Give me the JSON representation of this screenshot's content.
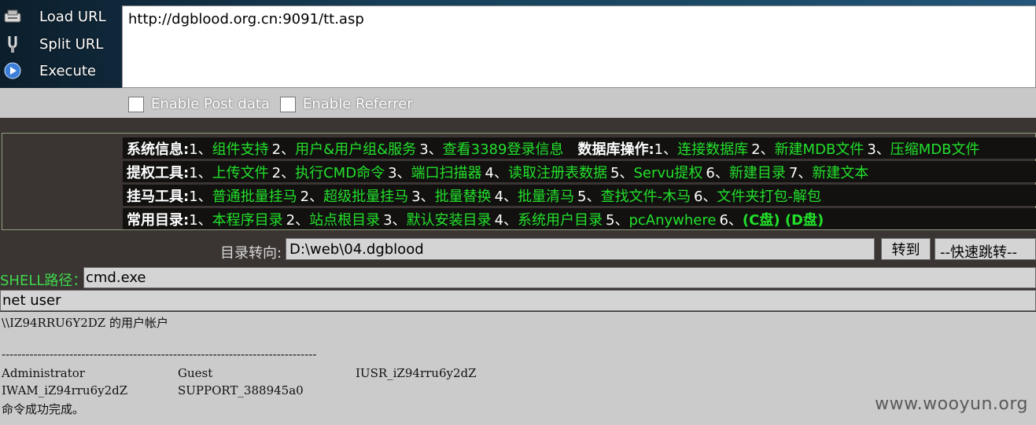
{
  "toolbar": {
    "load_url": "Load URL",
    "split_url": "Split URL",
    "execute": "Execute",
    "url_value": "http://dgblood.org.cn:9091/tt.asp",
    "enable_post": "Enable Post data",
    "enable_referrer": "Enable Referrer"
  },
  "menu": {
    "rows": [
      {
        "head": "系统信息:",
        "items": [
          {
            "n": "1、",
            "t": "组件支持"
          },
          {
            "n": "2、",
            "t": "用户&用户组&服务"
          },
          {
            "n": "3、",
            "t": "查看3389登录信息"
          }
        ],
        "sub_head": "数据库操作:",
        "sub_items": [
          {
            "n": "1、",
            "t": "连接数据库"
          },
          {
            "n": "2、",
            "t": "新建MDB文件"
          },
          {
            "n": "3、",
            "t": "压缩MDB文件"
          }
        ]
      },
      {
        "head": "提权工具:",
        "items": [
          {
            "n": "1、",
            "t": "上传文件"
          },
          {
            "n": "2、",
            "t": "执行CMD命令"
          },
          {
            "n": "3、",
            "t": "端口扫描器"
          },
          {
            "n": "4、",
            "t": "读取注册表数据"
          },
          {
            "n": "5、",
            "t": "Servu提权"
          },
          {
            "n": "6、",
            "t": "新建目录"
          },
          {
            "n": "7、",
            "t": "新建文本"
          }
        ]
      },
      {
        "head": "挂马工具:",
        "items": [
          {
            "n": "1、",
            "t": "普通批量挂马"
          },
          {
            "n": "2、",
            "t": "超级批量挂马"
          },
          {
            "n": "3、",
            "t": "批量替换"
          },
          {
            "n": "4、",
            "t": "批量清马"
          },
          {
            "n": "5、",
            "t": "查找文件-木马"
          },
          {
            "n": "6、",
            "t": "文件夹打包-解包"
          }
        ]
      },
      {
        "head": "常用目录:",
        "items": [
          {
            "n": "1、",
            "t": "本程序目录"
          },
          {
            "n": "2、",
            "t": "站点根目录"
          },
          {
            "n": "3、",
            "t": "默认安装目录"
          },
          {
            "n": "4、",
            "t": "系统用户目录"
          },
          {
            "n": "5、",
            "t": "pcAnywhere"
          },
          {
            "n": "6、",
            "t": "(C盘) (D盘)"
          }
        ]
      }
    ]
  },
  "dir": {
    "label": "目录转向:",
    "value": "D:\\web\\04.dgblood",
    "goto_label": "转到",
    "quick_jump": "--快速跳转--"
  },
  "shell": {
    "label": "SHELL路径：",
    "path_value": "cmd.exe",
    "command_value": "net user"
  },
  "output": {
    "header": "\\\\IZ94RRU6Y2DZ 的用户帐户",
    "separator": "-------------------------------------------------------------------------------",
    "users": [
      [
        "Administrator",
        "Guest",
        "IUSR_iZ94rru6y2dZ"
      ],
      [
        "IWAM_iZ94rru6y2dZ",
        "SUPPORT_388945a0",
        ""
      ]
    ],
    "done": "命令成功完成。"
  },
  "watermark": "www.wooyun.org",
  "icons": {
    "load_url": "load-url-icon",
    "split_url": "split-url-icon",
    "execute": "execute-icon"
  }
}
